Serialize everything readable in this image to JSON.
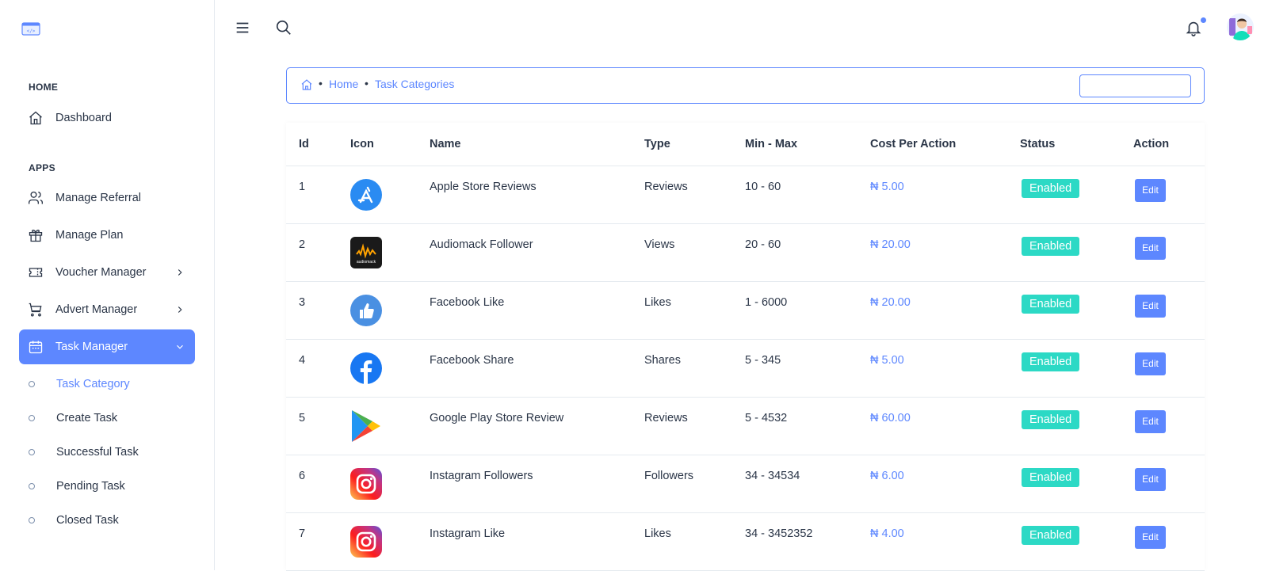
{
  "sidebar": {
    "sections": {
      "home": "HOME",
      "apps": "APPS"
    },
    "items": {
      "dashboard": "Dashboard",
      "manage_referral": "Manage Referral",
      "manage_plan": "Manage Plan",
      "voucher_manager": "Voucher Manager",
      "advert_manager": "Advert Manager",
      "task_manager": "Task Manager"
    },
    "sub_items": {
      "task_category": "Task Category",
      "create_task": "Create Task",
      "successful_task": "Successful Task",
      "pending_task": "Pending Task",
      "closed_task": "Closed Task"
    }
  },
  "breadcrumb": {
    "sep": "•",
    "home": "Home",
    "current": "Task Categories",
    "search_value": ""
  },
  "table": {
    "headers": {
      "id": "Id",
      "icon": "Icon",
      "name": "Name",
      "type": "Type",
      "minmax": "Min - Max",
      "cost": "Cost Per Action",
      "status": "Status",
      "action": "Action"
    },
    "rows": [
      {
        "id": "1",
        "icon": "app-store-icon",
        "name": "Apple Store Reviews",
        "type": "Reviews",
        "minmax": "10 - 60",
        "cost": "₦ 5.00",
        "status": "Enabled",
        "action": "Edit"
      },
      {
        "id": "2",
        "icon": "audiomack-icon",
        "name": "Audiomack Follower",
        "type": "Views",
        "minmax": "20 - 60",
        "cost": "₦ 20.00",
        "status": "Enabled",
        "action": "Edit"
      },
      {
        "id": "3",
        "icon": "thumbs-up-icon",
        "name": "Facebook Like",
        "type": "Likes",
        "minmax": "1 - 6000",
        "cost": "₦ 20.00",
        "status": "Enabled",
        "action": "Edit"
      },
      {
        "id": "4",
        "icon": "facebook-icon",
        "name": "Facebook Share",
        "type": "Shares",
        "minmax": "5 - 345",
        "cost": "₦ 5.00",
        "status": "Enabled",
        "action": "Edit"
      },
      {
        "id": "5",
        "icon": "google-play-icon",
        "name": "Google Play Store Review",
        "type": "Reviews",
        "minmax": "5 - 4532",
        "cost": "₦ 60.00",
        "status": "Enabled",
        "action": "Edit"
      },
      {
        "id": "6",
        "icon": "instagram-icon",
        "name": "Instagram Followers",
        "type": "Followers",
        "minmax": "34 - 34534",
        "cost": "₦ 6.00",
        "status": "Enabled",
        "action": "Edit"
      },
      {
        "id": "7",
        "icon": "instagram-icon",
        "name": "Instagram Like",
        "type": "Likes",
        "minmax": "34 - 3452352",
        "cost": "₦ 4.00",
        "status": "Enabled",
        "action": "Edit"
      }
    ]
  },
  "colors": {
    "primary": "#5d87ff",
    "success": "#2cd9c5",
    "text": "#2a3547"
  }
}
